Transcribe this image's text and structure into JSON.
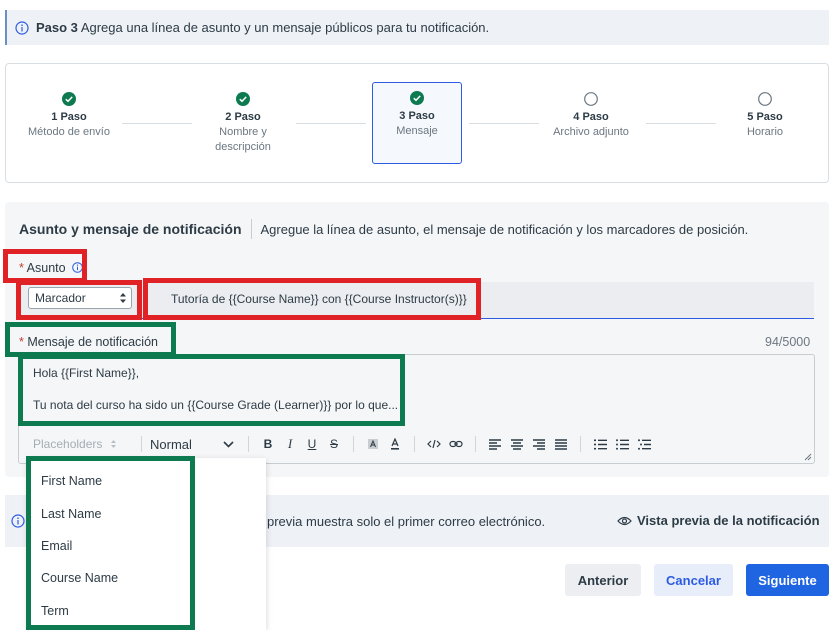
{
  "step_info": {
    "step": "Paso 3",
    "text": "Agrega una línea de asunto y un mensaje públicos para tu notificación."
  },
  "stepper": [
    {
      "num": "1 Paso",
      "label": "Método de envío",
      "status": "done"
    },
    {
      "num": "2 Paso",
      "label": "Nombre y descripción",
      "status": "done"
    },
    {
      "num": "3 Paso",
      "label": "Mensaje",
      "status": "active"
    },
    {
      "num": "4 Paso",
      "label": "Archivo adjunto",
      "status": "pending"
    },
    {
      "num": "5 Paso",
      "label": "Horario",
      "status": "pending"
    }
  ],
  "section": {
    "title": "Asunto y mensaje de notificación",
    "description": "Agregue la línea de asunto, el mensaje de notificación y los marcadores de posición."
  },
  "subject": {
    "label": "Asunto",
    "required_mark": "*",
    "marker_select": "Marcador",
    "value": "Tutoría de {{Course Name}} con {{Course Instructor(s)}}"
  },
  "message": {
    "label": "Mensaje de notificación",
    "required_mark": "*",
    "counter": "94/5000",
    "line1": "Hola {{First Name}},",
    "line2": "Tu nota del curso ha sido un {{Course Grade (Learner)}} por lo que..."
  },
  "toolbar": {
    "placeholders": "Placeholders",
    "format": "Normal",
    "bold": "B",
    "italic": "I",
    "underline": "U",
    "strike": "S"
  },
  "dropdown": [
    "First Name",
    "Last Name",
    "Email",
    "Course Name",
    "Term"
  ],
  "preview_info": {
    "text": "previa muestra solo el primer correo electrónico.",
    "link": "Vista previa de la notificación"
  },
  "buttons": {
    "previous": "Anterior",
    "cancel": "Cancelar",
    "next": "Siguiente"
  },
  "colors": {
    "primary": "#1f64e0",
    "success": "#0e7a50",
    "highlight_red": "#e02227",
    "highlight_green": "#0e7a50"
  }
}
